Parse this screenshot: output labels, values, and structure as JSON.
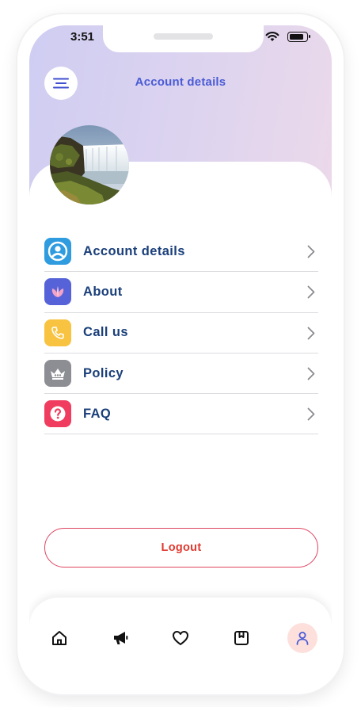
{
  "status_bar": {
    "time": "3:51"
  },
  "header": {
    "title": "Account details"
  },
  "menu": [
    {
      "id": "account-details",
      "label": "Account details",
      "icon": "user-circle-icon",
      "color": "#2f9ce0"
    },
    {
      "id": "about",
      "label": "About",
      "icon": "leaf-icon",
      "color": "#5663d8"
    },
    {
      "id": "call-us",
      "label": "Call us",
      "icon": "phone-icon",
      "color": "#f8c340"
    },
    {
      "id": "policy",
      "label": "Policy",
      "icon": "crown-icon",
      "color": "#8d8d94"
    },
    {
      "id": "faq",
      "label": "FAQ",
      "icon": "question-icon",
      "color": "#f03d5f"
    }
  ],
  "logout": {
    "label": "Logout",
    "color": "#e0392f"
  },
  "bottom_nav": [
    {
      "name": "home-icon",
      "active": false
    },
    {
      "name": "megaphone-icon",
      "active": false
    },
    {
      "name": "heart-icon",
      "active": false
    },
    {
      "name": "bookmark-icon",
      "active": false
    },
    {
      "name": "profile-icon",
      "active": true
    }
  ],
  "colors": {
    "title": "#4a5bd6",
    "menu_text": "#1a3f7a",
    "active_nav_bg": "#fde0dc"
  }
}
